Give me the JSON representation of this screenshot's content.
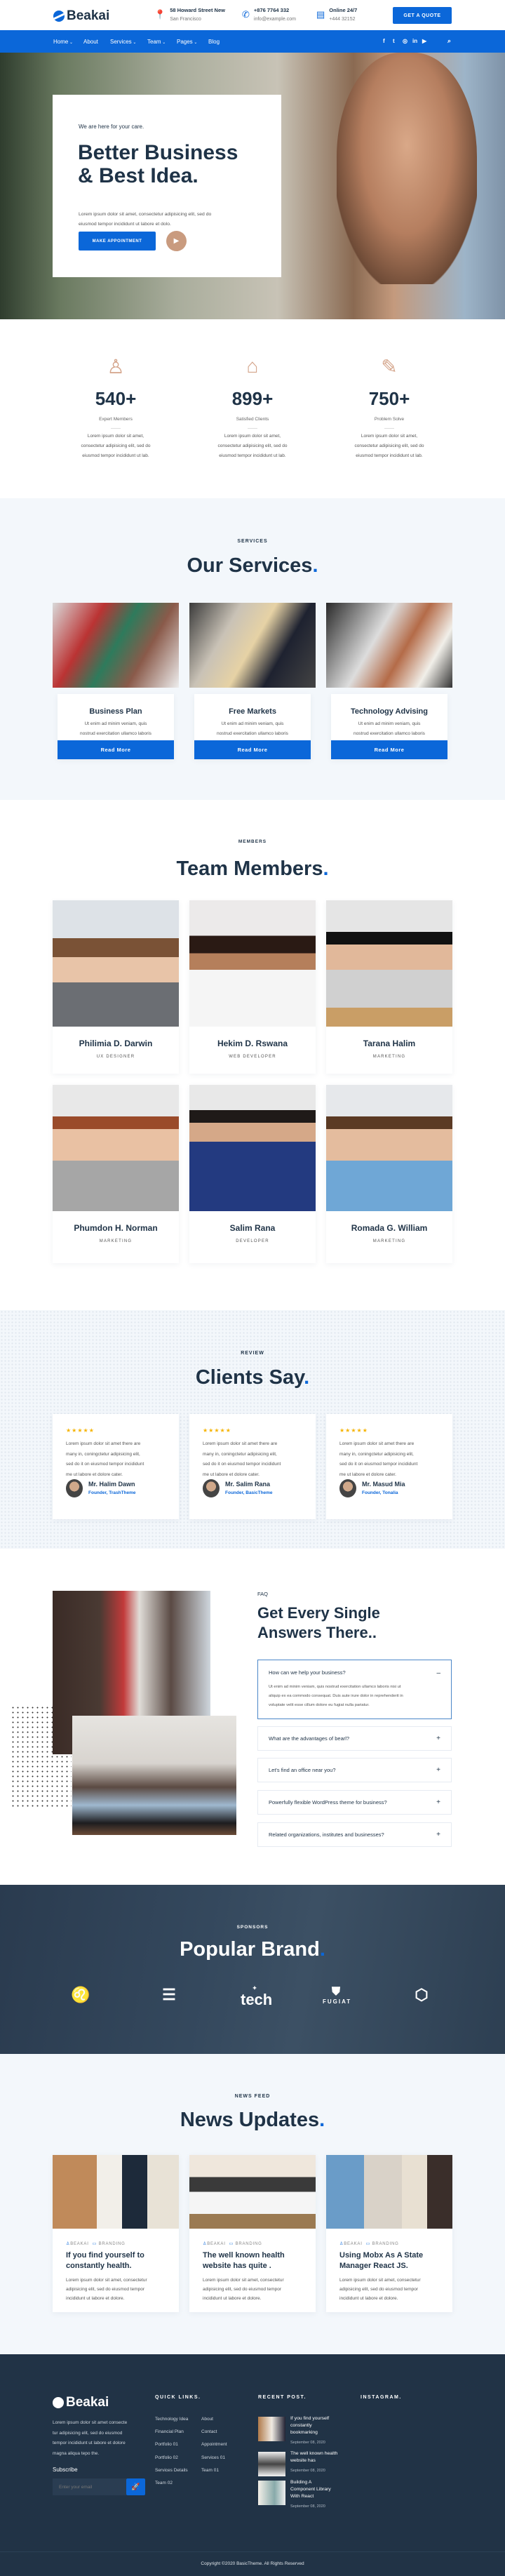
{
  "colors": {
    "primary": "#0b67d9",
    "dark": "#1f3347",
    "accent": "#d4a48a",
    "footer": "#213346",
    "light_bg": "#f3f7fb",
    "star": "#f5b301"
  },
  "header": {
    "brand": "Beakai",
    "address": {
      "icon": "map-pin-icon",
      "line1": "58 Howard Street New",
      "line2": "San Francisco"
    },
    "contact": {
      "icon": "phone-icon",
      "line1": "+876 7764 332",
      "line2": "info@example.com"
    },
    "support": {
      "icon": "chat-icon",
      "line1": "Online 24/7",
      "line2": "+444 32152"
    },
    "cta": "GET A QUOTE"
  },
  "nav": {
    "items": [
      {
        "label": "Home",
        "dropdown": true
      },
      {
        "label": "About",
        "dropdown": false
      },
      {
        "label": "Services",
        "dropdown": true
      },
      {
        "label": "Team",
        "dropdown": true
      },
      {
        "label": "Pages",
        "dropdown": true
      },
      {
        "label": "Blog",
        "dropdown": false
      }
    ],
    "social": [
      "facebook-icon",
      "twitter-icon",
      "instagram-icon",
      "linkedin-icon",
      "youtube-icon"
    ],
    "search_icon": "search-icon"
  },
  "hero": {
    "tagline": "We are here for your care.",
    "title_line1": "Better Business",
    "title_line2": "& Best Idea.",
    "text_line1": "Lorem ipsum dolor sit amet, consectetur adipisicing elit, sed do",
    "text_line2": "eiusmod tempor incididunt ut labore et dolo.",
    "button": "MAKE APPOINTMENT",
    "play_icon": "play-icon"
  },
  "stats": [
    {
      "icon": "user-icon",
      "number": "540+",
      "label": "Expert Members",
      "text": [
        "Lorem ipsum dolor sit amet,",
        "consectetur adipisicing elit, sed do",
        "eiusmod tempor incididunt ut lab."
      ]
    },
    {
      "icon": "home-icon",
      "number": "899+",
      "label": "Satisfied Clients",
      "text": [
        "Lorem ipsum dolor sit amet,",
        "consectetur adipisicing elit, sed do",
        "eiusmod tempor incididunt ut lab."
      ]
    },
    {
      "icon": "pen-icon",
      "number": "750+",
      "label": "Problem Solve",
      "text": [
        "Lorem ipsum dolor sit amet,",
        "consectetur adipisicing elit, sed do",
        "eiusmod tempor incididunt ut lab."
      ]
    }
  ],
  "services": {
    "eyebrow": "SERVICES",
    "title": "Our Services",
    "dot": ".",
    "items": [
      {
        "title": "Business Plan",
        "text": [
          "Ut enim ad minim veniam, quis",
          "nostrud exercitation ullamco laboris",
          "nisi ut aliquip ex ea commodo."
        ],
        "button": "Read More"
      },
      {
        "title": "Free Markets",
        "text": [
          "Ut enim ad minim veniam, quis",
          "nostrud exercitation ullamco laboris",
          "nisi ut aliquip ex ea commodo."
        ],
        "button": "Read More"
      },
      {
        "title": "Technology Advising",
        "text": [
          "Ut enim ad minim veniam, quis",
          "nostrud exercitation ullamco laboris",
          "nisi ut aliquip ex ea commodo."
        ],
        "button": "Read More"
      }
    ]
  },
  "team": {
    "eyebrow": "MEMBERS",
    "title": "Team Members",
    "dot": ".",
    "members": [
      {
        "name": "Philimia D. Darwin",
        "role": "UX DESIGNER"
      },
      {
        "name": "Hekim D. Rswana",
        "role": "WEB DEVELOPER"
      },
      {
        "name": "Tarana Halim",
        "role": "MARKETING"
      },
      {
        "name": "Phumdon H. Norman",
        "role": "MARKETING"
      },
      {
        "name": "Salim Rana",
        "role": "DEVELOPER"
      },
      {
        "name": "Romada G. William",
        "role": "MARKETING"
      }
    ]
  },
  "reviews": {
    "eyebrow": "REVIEW",
    "title": "Clients Say",
    "dot": ".",
    "items": [
      {
        "rating": 5,
        "text": [
          "Lorem ipsum dolor sit amet there are",
          "many in, coningctetur adipisicing elit,",
          "sed do it on eiusmod tempor incididunt",
          "me ut labore et dolore cater."
        ],
        "name": "Mr. Halim Dawn",
        "role": "Founder, TrashTheme"
      },
      {
        "rating": 5,
        "text": [
          "Lorem ipsum dolor sit amet there are",
          "many in, coningctetur adipisicing elit,",
          "sed do it on eiusmod tempor incididunt",
          "me ut labore et dolore cater."
        ],
        "name": "Mr. Salim Rana",
        "role": "Founder, BasicTheme"
      },
      {
        "rating": 5,
        "text": [
          "Lorem ipsum dolor sit amet there are",
          "many in, coningctetur adipisicing elit,",
          "sed do it on eiusmod tempor incididunt",
          "me ut labore et dolore cater."
        ],
        "name": "Mr. Masud Mia",
        "role": "Founder, Tonalia"
      }
    ]
  },
  "faq": {
    "eyebrow": "FAQ",
    "title_line1": "Get Every Single",
    "title_line2": "Answers There..",
    "items": [
      {
        "q": "How can we help your business?",
        "open": true,
        "a": [
          "Ut enim ad minim veniam, quis nostrud exercitation ullamco laboris nisi ut",
          "aliquip ex ea commodo consequat. Duis aute irure dolor in reprehenderit in",
          "voluptate velit esse cillum dolore eu fugiat nulla pariatur."
        ]
      },
      {
        "q": "What are the advantages of bearl?",
        "open": false
      },
      {
        "q": "Let's find an office near you?",
        "open": false
      },
      {
        "q": "Powerfully flexible WordPress theme for business?",
        "open": false
      },
      {
        "q": "Related organizations, institutes and businesses?",
        "open": false
      }
    ],
    "minus": "–",
    "plus": "+"
  },
  "brands": {
    "eyebrow": "SPONSORS",
    "title": "Popular Brand",
    "dot": ".",
    "logos": [
      {
        "icon": "lion-logo-icon",
        "text": ""
      },
      {
        "icon": "s-maze-logo-icon",
        "text": ""
      },
      {
        "icon": "tech-company-logo-icon",
        "text": "tech"
      },
      {
        "icon": "fugiat-shield-logo-icon",
        "text": "FUGIAT"
      },
      {
        "icon": "polygon-badge-logo-icon",
        "text": ""
      }
    ]
  },
  "news": {
    "eyebrow": "NEWS FEED",
    "title": "News Updates",
    "dot": ".",
    "items": [
      {
        "author": "BEAKAI",
        "category": "BRANDING",
        "title": [
          "If you find yourself to",
          "constantly health."
        ],
        "text": [
          "Lorem ipsum dolor sit amet, consectetur",
          "adipisicing elit, sed do eiusmod tempor",
          "incididunt ut labore et dolore."
        ]
      },
      {
        "author": "BEAKAI",
        "category": "BRANDING",
        "title": [
          "The well known health",
          "website has quite ."
        ],
        "text": [
          "Lorem ipsum dolor sit amet, consectetur",
          "adipisicing elit, sed do eiusmod tempor",
          "incididunt ut labore et dolore."
        ]
      },
      {
        "author": "BEAKAI",
        "category": "BRANDING",
        "title": [
          "Using Mobx As A State",
          "Manager React JS."
        ],
        "text": [
          "Lorem ipsum dolor sit amet, consectetur",
          "adipisicing elit, sed do eiusmod tempor",
          "incididunt ut labore et dolore."
        ]
      }
    ]
  },
  "footer": {
    "brand": "Beakai",
    "about": [
      "Lorem ipsum dolor sit amet consecte",
      "tur adipisicing elit, sed do eiusmod",
      "tempor incididunt ut labore et dolore",
      "magna aliqua tepo the."
    ],
    "subscribe_label": "Subscribe",
    "email_placeholder": "Enter your email",
    "send_icon": "rocket-icon",
    "quick_links_title": "QUICK LINKS.",
    "quick_links_col1": [
      "Technology Idea",
      "Financial Plan",
      "Portfolio 01",
      "Portfolio 02",
      "Services Details",
      "Team 02"
    ],
    "quick_links_col2": [
      "About",
      "Contact",
      "Appointment",
      "Services 01",
      "Team 01"
    ],
    "recent_title": "RECENT POST.",
    "recent_posts": [
      {
        "title": [
          "If you find yourself",
          "constantly",
          "bookmarking"
        ],
        "date": "September 08, 2020"
      },
      {
        "title": [
          "The well known health",
          "website has"
        ],
        "date": "September 08, 2020"
      },
      {
        "title": [
          "Building A",
          "Component Library",
          "With React"
        ],
        "date": "September 08, 2020"
      }
    ],
    "instagram_title": "INSTAGRAM.",
    "copyright": "Copyright ©2020 BasicTheme. All Rights Reserved"
  }
}
